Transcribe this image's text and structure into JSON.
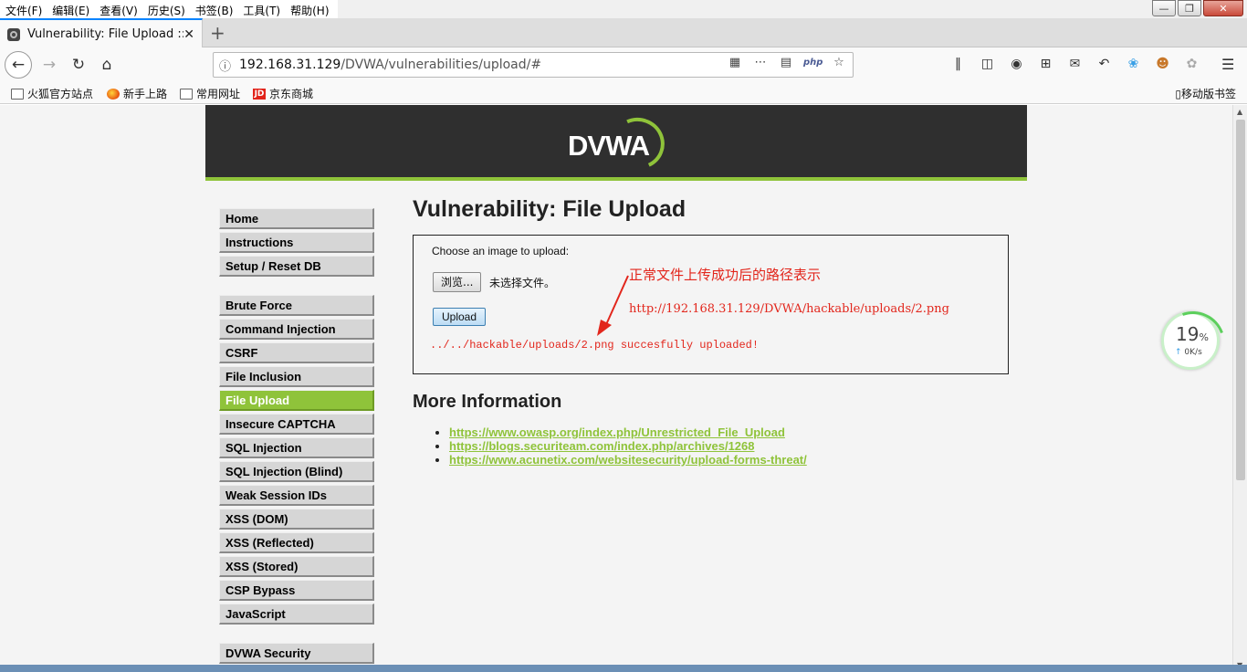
{
  "menubar": {
    "items": [
      "文件(F)",
      "编辑(E)",
      "查看(V)",
      "历史(S)",
      "书签(B)",
      "工具(T)",
      "帮助(H)"
    ]
  },
  "tab": {
    "title": "Vulnerability: File Upload :: D"
  },
  "urlbar": {
    "host": "192.168.31.129",
    "path": "/DVWA/vulnerabilities/upload/#",
    "php_label": "php"
  },
  "bookmarks": {
    "items": [
      "火狐官方站点",
      "新手上路",
      "常用网址",
      "京东商城"
    ],
    "mobile": "移动版书签"
  },
  "logo_text": "DVWA",
  "sidebar": {
    "group1": [
      "Home",
      "Instructions",
      "Setup / Reset DB"
    ],
    "group2": [
      "Brute Force",
      "Command Injection",
      "CSRF",
      "File Inclusion",
      "File Upload",
      "Insecure CAPTCHA",
      "SQL Injection",
      "SQL Injection (Blind)",
      "Weak Session IDs",
      "XSS (DOM)",
      "XSS (Reflected)",
      "XSS (Stored)",
      "CSP Bypass",
      "JavaScript"
    ],
    "group3": [
      "DVWA Security"
    ],
    "active": "File Upload"
  },
  "main": {
    "title": "Vulnerability: File Upload",
    "prompt": "Choose an image to upload:",
    "browse_label": "浏览...",
    "no_file": "未选择文件。",
    "upload_label": "Upload",
    "success_msg": "../../hackable/uploads/2.png succesfully uploaded!",
    "annotation_title": "正常文件上传成功后的路径表示",
    "annotation_url": "http://192.168.31.129/DVWA/hackable/uploads/2.png",
    "more_info": "More Information",
    "links": [
      "https://www.owasp.org/index.php/Unrestricted_File_Upload",
      "https://blogs.securiteam.com/index.php/archives/1268",
      "https://www.acunetix.com/websitesecurity/upload-forms-threat/"
    ]
  },
  "speed_widget": {
    "percent": "19",
    "percent_sign": "%",
    "rate": "0K/s"
  },
  "colors": {
    "accent": "#8fc33a",
    "header_bg": "#2f2f2f",
    "annotation_red": "#e2261c"
  }
}
